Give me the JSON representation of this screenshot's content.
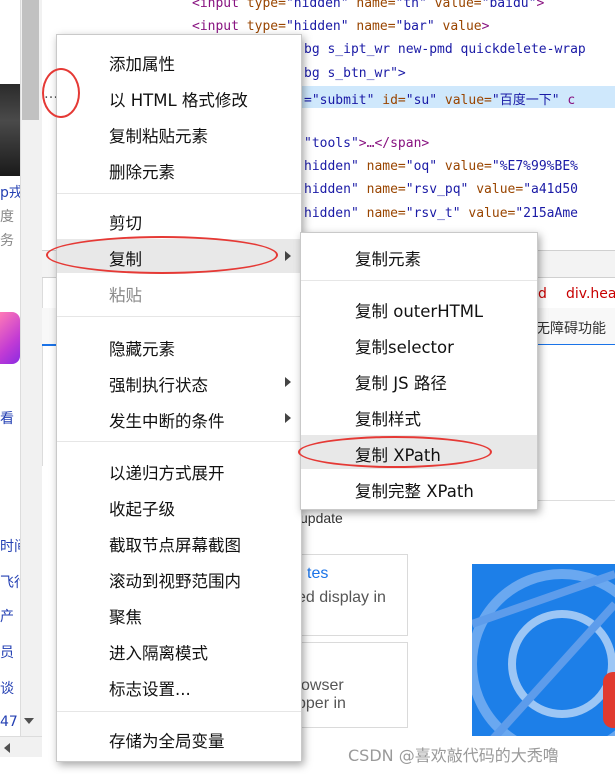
{
  "page_strip": {
    "texts": [
      {
        "text": "p戎",
        "link": true
      },
      {
        "text": "度",
        "link": false
      },
      {
        "text": "务",
        "link": false
      },
      {
        "text": "看",
        "link": true
      },
      {
        "text": "时间",
        "link": true
      },
      {
        "text": "飞行",
        "link": true
      },
      {
        "text": "产",
        "link": true
      },
      {
        "text": "员",
        "link": true
      },
      {
        "text": "谈",
        "link": true
      },
      {
        "text": "47",
        "link": true
      }
    ]
  },
  "code": {
    "lines": [
      {
        "tag_open": "<input ",
        "a1": "type=",
        "v1": "\"hidden\"",
        "a2": " name=",
        "v2": "\"tn\"",
        "a3": " value=",
        "v3": "\"baidu\"",
        "tail": ">"
      },
      {
        "tag_open": "<input ",
        "a1": "type=",
        "v1": "\"hidden\"",
        "a2": " name=",
        "v2": "\"bar\"",
        "a3": " value",
        "v3": "",
        "tail": ">"
      },
      {
        "tag_open": "",
        "a1": "",
        "v1": "",
        "a2": "",
        "v2": "",
        "a3": "bg s_ipt_wr new-pmd quickdelete-wrap",
        "v3": "",
        "tail": ""
      },
      {
        "tag_open": "",
        "a1": "",
        "v1": "",
        "a2": "",
        "v2": "",
        "a3": "bg s_btn_wr\">",
        "v3": "",
        "tail": ""
      },
      {
        "tag_open": "",
        "a1": "",
        "v1": "=\"submit\"",
        "a2": " id=",
        "v2": "\"su\"",
        "a3": " value=",
        "v3": "\"百度一下\"",
        "tail": " c"
      },
      {
        "tag_open": "",
        "a1": "",
        "v1": "",
        "a2": "",
        "v2": "",
        "a3": "",
        "v3": "",
        "tail": ""
      },
      {
        "tag_open": "",
        "a1": "",
        "v1": "\"tools\"",
        "a2": "",
        "v2": "",
        "a3": "",
        "v3": "",
        "tail": ">…</span>"
      },
      {
        "tag_open": "",
        "a1": "",
        "v1": "hidden\"",
        "a2": " name=",
        "v2": "\"oq\"",
        "a3": " value=",
        "v3": "\"%E7%99%BE%",
        "tail": ""
      },
      {
        "tag_open": "",
        "a1": "",
        "v1": "hidden\"",
        "a2": " name=",
        "v2": "\"rsv_pq\"",
        "a3": " value=",
        "v3": "\"a41d50",
        "tail": ""
      },
      {
        "tag_open": "",
        "a1": "",
        "v1": "hidden\"",
        "a2": " name=",
        "v2": "\"rsv_t\"",
        "a3": " value=",
        "v3": "\"215aAme",
        "tail": ""
      }
    ]
  },
  "panel": {
    "breadcrumb_1": "d",
    "breadcrumb_2": "div.hea",
    "accessibility": "无障碍功能",
    "update_text": "update",
    "card1_link": "tes",
    "card1_text": "ed display in",
    "card2_text1": "owser",
    "card2_text2": "pper in"
  },
  "main_menu": {
    "items": [
      {
        "label": "添加属性",
        "disabled": false,
        "submenu": false
      },
      {
        "label": "以 HTML 格式修改",
        "disabled": false,
        "submenu": false
      },
      {
        "label": "复制粘贴元素",
        "disabled": false,
        "submenu": false
      },
      {
        "label": "删除元素",
        "disabled": false,
        "submenu": false
      },
      {
        "label": "剪切",
        "disabled": false,
        "submenu": false
      },
      {
        "label": "复制",
        "disabled": false,
        "submenu": true
      },
      {
        "label": "粘贴",
        "disabled": true,
        "submenu": false
      },
      {
        "label": "隐藏元素",
        "disabled": false,
        "submenu": false
      },
      {
        "label": "强制执行状态",
        "disabled": false,
        "submenu": true
      },
      {
        "label": "发生中断的条件",
        "disabled": false,
        "submenu": true
      },
      {
        "label": "以递归方式展开",
        "disabled": false,
        "submenu": false
      },
      {
        "label": "收起子级",
        "disabled": false,
        "submenu": false
      },
      {
        "label": "截取节点屏幕截图",
        "disabled": false,
        "submenu": false
      },
      {
        "label": "滚动到视野范围内",
        "disabled": false,
        "submenu": false
      },
      {
        "label": "聚焦",
        "disabled": false,
        "submenu": false
      },
      {
        "label": "进入隔离模式",
        "disabled": false,
        "submenu": false
      },
      {
        "label": "标志设置...",
        "disabled": false,
        "submenu": false
      },
      {
        "label": "存储为全局变量",
        "disabled": false,
        "submenu": false
      }
    ]
  },
  "sub_menu": {
    "items": [
      {
        "label": "复制元素"
      },
      {
        "label": "复制 outerHTML"
      },
      {
        "label": "复制selector"
      },
      {
        "label": "复制 JS 路径"
      },
      {
        "label": "复制样式"
      },
      {
        "label": "复制 XPath"
      },
      {
        "label": "复制完整 XPath"
      }
    ]
  },
  "gutter": {
    "ellipsis": "…"
  },
  "watermark": "CSDN @喜欢敲代码的大秃噜"
}
